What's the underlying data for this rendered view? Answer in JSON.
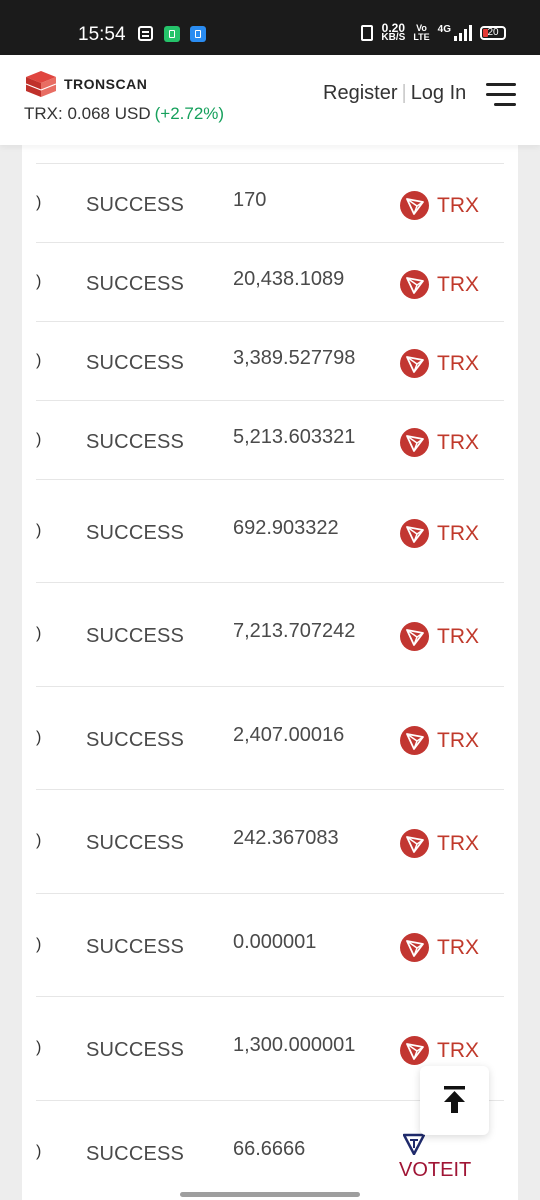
{
  "status_bar": {
    "time": "15:54",
    "net_speed_value": "0.20",
    "net_speed_unit": "KB/S",
    "volte_top": "Vo",
    "volte_bottom": "LTE",
    "network": "4G",
    "battery": "20"
  },
  "header": {
    "brand": "TRONSCAN",
    "price_label": "TRX: 0.068 USD",
    "price_change": "(+2.72%)",
    "register_label": "Register",
    "separator": "|",
    "login_label": "Log In"
  },
  "rows": [
    {
      "edge": ")",
      "status": "SUCCESS",
      "amount": "170",
      "token": "TRX"
    },
    {
      "edge": ")",
      "status": "SUCCESS",
      "amount": "20,438.1089",
      "token": "TRX"
    },
    {
      "edge": ")",
      "status": "SUCCESS",
      "amount": "3,389.527798",
      "token": "TRX"
    },
    {
      "edge": ")",
      "status": "SUCCESS",
      "amount": "5,213.603321",
      "token": "TRX"
    },
    {
      "edge": ")",
      "status": "SUCCESS",
      "amount": "692.903322",
      "token": "TRX"
    },
    {
      "edge": ")",
      "status": "SUCCESS",
      "amount": "7,213.707242",
      "token": "TRX"
    },
    {
      "edge": ")",
      "status": "SUCCESS",
      "amount": "2,407.00016",
      "token": "TRX"
    },
    {
      "edge": ")",
      "status": "SUCCESS",
      "amount": "242.367083",
      "token": "TRX"
    },
    {
      "edge": ")",
      "status": "SUCCESS",
      "amount": "0.000001",
      "token": "TRX"
    },
    {
      "edge": ")",
      "status": "SUCCESS",
      "amount": "1,300.000001",
      "token": "TRX"
    },
    {
      "edge": ")",
      "status": "SUCCESS",
      "amount": "66.6666",
      "token": "VOTEIT"
    }
  ],
  "colors": {
    "accent_red": "#c23631",
    "positive_green": "#16a05c",
    "voteit": "#a01535"
  },
  "icons": {
    "trx": "trx-token-icon",
    "voteit": "voteit-token-icon",
    "back_to_top": "arrow-up-to-top-icon",
    "menu": "hamburger-menu-icon"
  }
}
